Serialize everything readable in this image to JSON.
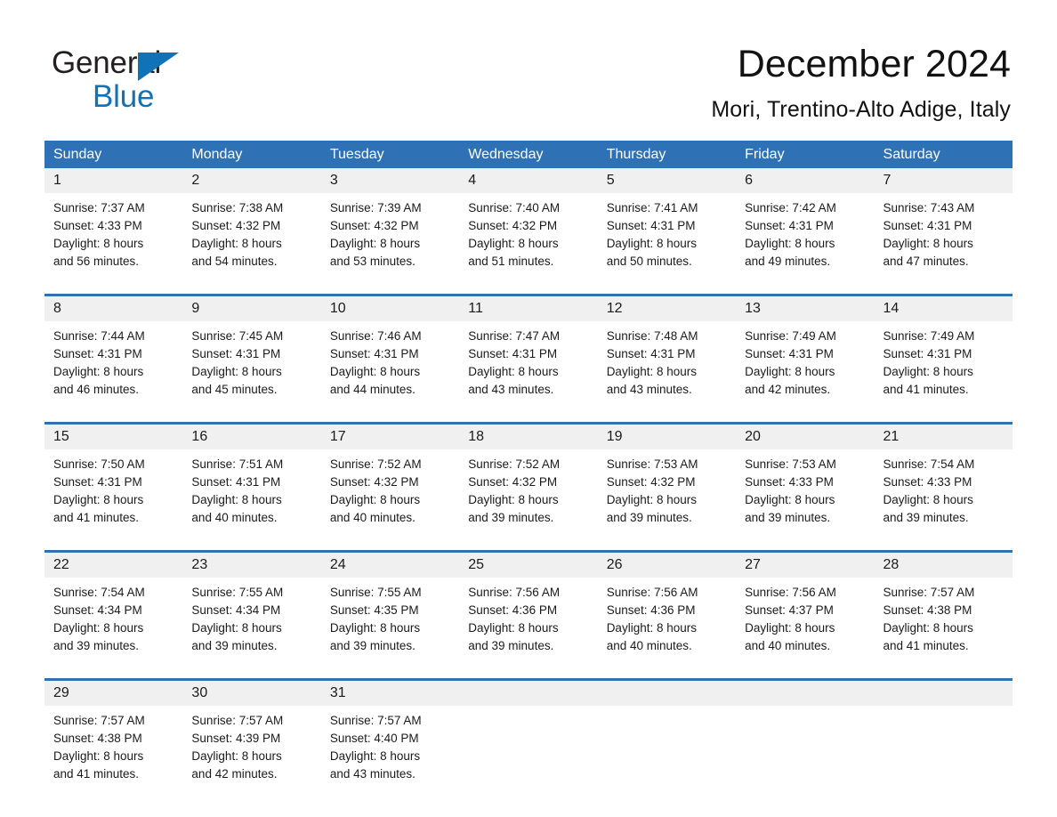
{
  "brand": {
    "name_part1": "General",
    "name_part2": "Blue",
    "triangle_icon": "triangle-icon",
    "color_blue": "#1272b8"
  },
  "header": {
    "month_title": "December 2024",
    "location": "Mori, Trentino-Alto Adige, Italy"
  },
  "theme": {
    "header_blue": "#2e72b5",
    "day_band_gray": "#f0f0f0",
    "text_black": "#1b1b1b"
  },
  "calendar": {
    "day_headers": [
      "Sunday",
      "Monday",
      "Tuesday",
      "Wednesday",
      "Thursday",
      "Friday",
      "Saturday"
    ],
    "weeks": [
      [
        {
          "day": "1",
          "sunrise": "Sunrise: 7:37 AM",
          "sunset": "Sunset: 4:33 PM",
          "daylight_line1": "Daylight: 8 hours",
          "daylight_line2": "and 56 minutes."
        },
        {
          "day": "2",
          "sunrise": "Sunrise: 7:38 AM",
          "sunset": "Sunset: 4:32 PM",
          "daylight_line1": "Daylight: 8 hours",
          "daylight_line2": "and 54 minutes."
        },
        {
          "day": "3",
          "sunrise": "Sunrise: 7:39 AM",
          "sunset": "Sunset: 4:32 PM",
          "daylight_line1": "Daylight: 8 hours",
          "daylight_line2": "and 53 minutes."
        },
        {
          "day": "4",
          "sunrise": "Sunrise: 7:40 AM",
          "sunset": "Sunset: 4:32 PM",
          "daylight_line1": "Daylight: 8 hours",
          "daylight_line2": "and 51 minutes."
        },
        {
          "day": "5",
          "sunrise": "Sunrise: 7:41 AM",
          "sunset": "Sunset: 4:31 PM",
          "daylight_line1": "Daylight: 8 hours",
          "daylight_line2": "and 50 minutes."
        },
        {
          "day": "6",
          "sunrise": "Sunrise: 7:42 AM",
          "sunset": "Sunset: 4:31 PM",
          "daylight_line1": "Daylight: 8 hours",
          "daylight_line2": "and 49 minutes."
        },
        {
          "day": "7",
          "sunrise": "Sunrise: 7:43 AM",
          "sunset": "Sunset: 4:31 PM",
          "daylight_line1": "Daylight: 8 hours",
          "daylight_line2": "and 47 minutes."
        }
      ],
      [
        {
          "day": "8",
          "sunrise": "Sunrise: 7:44 AM",
          "sunset": "Sunset: 4:31 PM",
          "daylight_line1": "Daylight: 8 hours",
          "daylight_line2": "and 46 minutes."
        },
        {
          "day": "9",
          "sunrise": "Sunrise: 7:45 AM",
          "sunset": "Sunset: 4:31 PM",
          "daylight_line1": "Daylight: 8 hours",
          "daylight_line2": "and 45 minutes."
        },
        {
          "day": "10",
          "sunrise": "Sunrise: 7:46 AM",
          "sunset": "Sunset: 4:31 PM",
          "daylight_line1": "Daylight: 8 hours",
          "daylight_line2": "and 44 minutes."
        },
        {
          "day": "11",
          "sunrise": "Sunrise: 7:47 AM",
          "sunset": "Sunset: 4:31 PM",
          "daylight_line1": "Daylight: 8 hours",
          "daylight_line2": "and 43 minutes."
        },
        {
          "day": "12",
          "sunrise": "Sunrise: 7:48 AM",
          "sunset": "Sunset: 4:31 PM",
          "daylight_line1": "Daylight: 8 hours",
          "daylight_line2": "and 43 minutes."
        },
        {
          "day": "13",
          "sunrise": "Sunrise: 7:49 AM",
          "sunset": "Sunset: 4:31 PM",
          "daylight_line1": "Daylight: 8 hours",
          "daylight_line2": "and 42 minutes."
        },
        {
          "day": "14",
          "sunrise": "Sunrise: 7:49 AM",
          "sunset": "Sunset: 4:31 PM",
          "daylight_line1": "Daylight: 8 hours",
          "daylight_line2": "and 41 minutes."
        }
      ],
      [
        {
          "day": "15",
          "sunrise": "Sunrise: 7:50 AM",
          "sunset": "Sunset: 4:31 PM",
          "daylight_line1": "Daylight: 8 hours",
          "daylight_line2": "and 41 minutes."
        },
        {
          "day": "16",
          "sunrise": "Sunrise: 7:51 AM",
          "sunset": "Sunset: 4:31 PM",
          "daylight_line1": "Daylight: 8 hours",
          "daylight_line2": "and 40 minutes."
        },
        {
          "day": "17",
          "sunrise": "Sunrise: 7:52 AM",
          "sunset": "Sunset: 4:32 PM",
          "daylight_line1": "Daylight: 8 hours",
          "daylight_line2": "and 40 minutes."
        },
        {
          "day": "18",
          "sunrise": "Sunrise: 7:52 AM",
          "sunset": "Sunset: 4:32 PM",
          "daylight_line1": "Daylight: 8 hours",
          "daylight_line2": "and 39 minutes."
        },
        {
          "day": "19",
          "sunrise": "Sunrise: 7:53 AM",
          "sunset": "Sunset: 4:32 PM",
          "daylight_line1": "Daylight: 8 hours",
          "daylight_line2": "and 39 minutes."
        },
        {
          "day": "20",
          "sunrise": "Sunrise: 7:53 AM",
          "sunset": "Sunset: 4:33 PM",
          "daylight_line1": "Daylight: 8 hours",
          "daylight_line2": "and 39 minutes."
        },
        {
          "day": "21",
          "sunrise": "Sunrise: 7:54 AM",
          "sunset": "Sunset: 4:33 PM",
          "daylight_line1": "Daylight: 8 hours",
          "daylight_line2": "and 39 minutes."
        }
      ],
      [
        {
          "day": "22",
          "sunrise": "Sunrise: 7:54 AM",
          "sunset": "Sunset: 4:34 PM",
          "daylight_line1": "Daylight: 8 hours",
          "daylight_line2": "and 39 minutes."
        },
        {
          "day": "23",
          "sunrise": "Sunrise: 7:55 AM",
          "sunset": "Sunset: 4:34 PM",
          "daylight_line1": "Daylight: 8 hours",
          "daylight_line2": "and 39 minutes."
        },
        {
          "day": "24",
          "sunrise": "Sunrise: 7:55 AM",
          "sunset": "Sunset: 4:35 PM",
          "daylight_line1": "Daylight: 8 hours",
          "daylight_line2": "and 39 minutes."
        },
        {
          "day": "25",
          "sunrise": "Sunrise: 7:56 AM",
          "sunset": "Sunset: 4:36 PM",
          "daylight_line1": "Daylight: 8 hours",
          "daylight_line2": "and 39 minutes."
        },
        {
          "day": "26",
          "sunrise": "Sunrise: 7:56 AM",
          "sunset": "Sunset: 4:36 PM",
          "daylight_line1": "Daylight: 8 hours",
          "daylight_line2": "and 40 minutes."
        },
        {
          "day": "27",
          "sunrise": "Sunrise: 7:56 AM",
          "sunset": "Sunset: 4:37 PM",
          "daylight_line1": "Daylight: 8 hours",
          "daylight_line2": "and 40 minutes."
        },
        {
          "day": "28",
          "sunrise": "Sunrise: 7:57 AM",
          "sunset": "Sunset: 4:38 PM",
          "daylight_line1": "Daylight: 8 hours",
          "daylight_line2": "and 41 minutes."
        }
      ],
      [
        {
          "day": "29",
          "sunrise": "Sunrise: 7:57 AM",
          "sunset": "Sunset: 4:38 PM",
          "daylight_line1": "Daylight: 8 hours",
          "daylight_line2": "and 41 minutes."
        },
        {
          "day": "30",
          "sunrise": "Sunrise: 7:57 AM",
          "sunset": "Sunset: 4:39 PM",
          "daylight_line1": "Daylight: 8 hours",
          "daylight_line2": "and 42 minutes."
        },
        {
          "day": "31",
          "sunrise": "Sunrise: 7:57 AM",
          "sunset": "Sunset: 4:40 PM",
          "daylight_line1": "Daylight: 8 hours",
          "daylight_line2": "and 43 minutes."
        },
        {
          "day": "",
          "sunrise": "",
          "sunset": "",
          "daylight_line1": "",
          "daylight_line2": ""
        },
        {
          "day": "",
          "sunrise": "",
          "sunset": "",
          "daylight_line1": "",
          "daylight_line2": ""
        },
        {
          "day": "",
          "sunrise": "",
          "sunset": "",
          "daylight_line1": "",
          "daylight_line2": ""
        },
        {
          "day": "",
          "sunrise": "",
          "sunset": "",
          "daylight_line1": "",
          "daylight_line2": ""
        }
      ]
    ]
  }
}
